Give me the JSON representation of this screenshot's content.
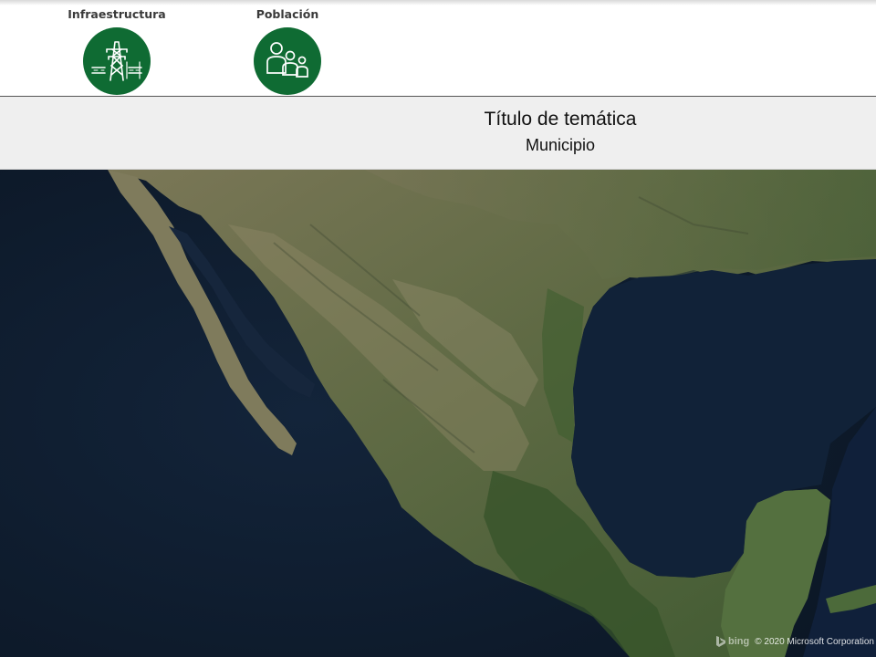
{
  "categories": [
    {
      "label": "Infraestructura",
      "icon": "power-tower-icon",
      "color": "#0f6b33"
    },
    {
      "label": "Población",
      "icon": "people-group-icon",
      "color": "#0f6b33"
    }
  ],
  "header": {
    "title": "Título de temática",
    "subtitle": "Municipio"
  },
  "map": {
    "provider": "bing",
    "copyright": "© 2020 Microsoft Corporation",
    "colors": {
      "ocean": "#0f1d2f",
      "gulf": "#112238",
      "land": "#56613f",
      "land_light": "#8a8665",
      "vegetation": "#3e5a2e"
    }
  }
}
